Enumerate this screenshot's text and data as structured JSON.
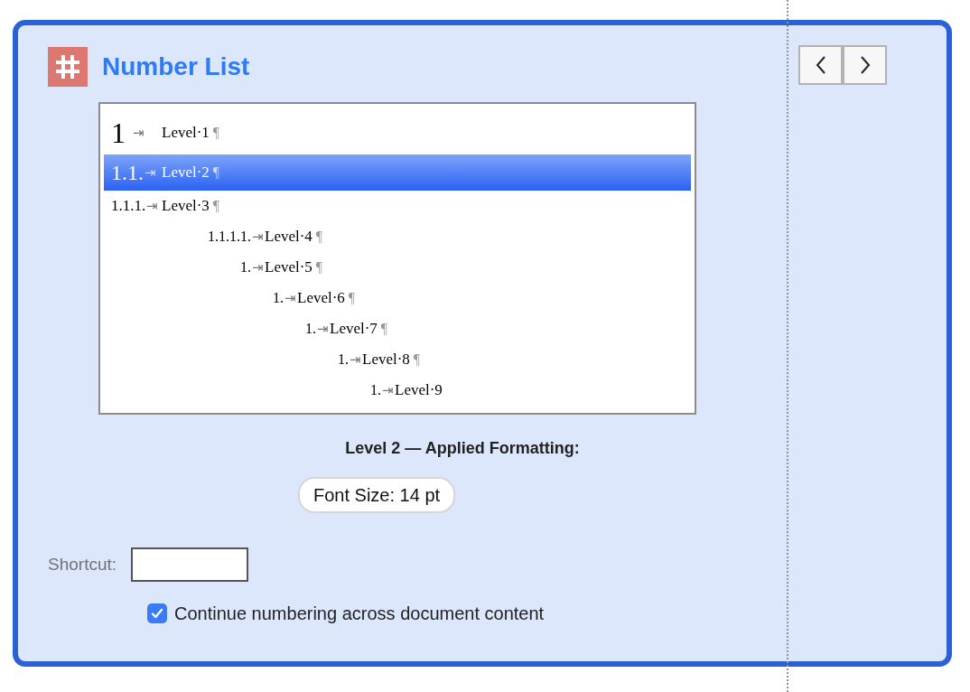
{
  "panel": {
    "title": "Number List"
  },
  "preview_rows": [
    {
      "number": "1",
      "tab_mark": "⇥",
      "text": "Level·1",
      "end_mark": "¶",
      "selected": false
    },
    {
      "number": "1.1.",
      "tab_mark": "⇥",
      "text": "Level·2",
      "end_mark": "¶",
      "selected": true
    },
    {
      "number": "1.1.1.",
      "tab_mark": "⇥",
      "text": "Level·3",
      "end_mark": "¶",
      "selected": false
    },
    {
      "number": "1.1.1.1.",
      "tab_mark": "⇥",
      "text": "Level·4",
      "end_mark": "¶",
      "selected": false
    },
    {
      "number": "1.",
      "tab_mark": "⇥",
      "text": "Level·5",
      "end_mark": "¶",
      "selected": false
    },
    {
      "number": "1.",
      "tab_mark": "⇥",
      "text": "Level·6",
      "end_mark": "¶",
      "selected": false
    },
    {
      "number": "1.",
      "tab_mark": "⇥",
      "text": "Level·7",
      "end_mark": "¶",
      "selected": false
    },
    {
      "number": "1.",
      "tab_mark": "⇥",
      "text": "Level·8",
      "end_mark": "¶",
      "selected": false
    },
    {
      "number": "1.",
      "tab_mark": "⇥",
      "text": "Level·9",
      "selected": false
    }
  ],
  "formatting": {
    "heading": "Level 2 — Applied Formatting:",
    "tags": [
      "Font Size: 14 pt"
    ]
  },
  "shortcut": {
    "label": "Shortcut:"
  },
  "continue_numbering": {
    "label": "Continue numbering across document content",
    "checked": true
  }
}
